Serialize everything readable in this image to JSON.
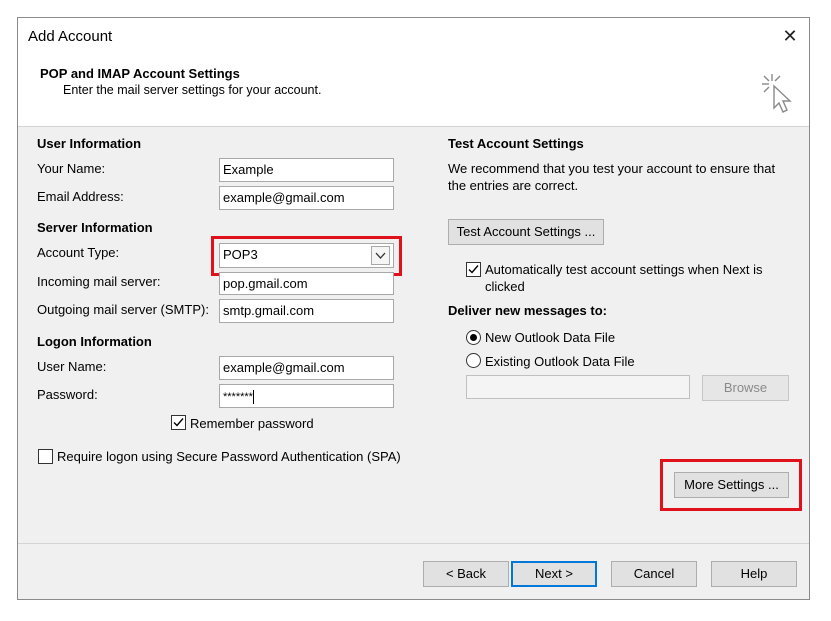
{
  "window": {
    "title": "Add Account",
    "close_glyph": "✕"
  },
  "header": {
    "title": "POP and IMAP Account Settings",
    "subtitle": "Enter the mail server settings for your account."
  },
  "user_info": {
    "heading": "User Information",
    "name_label": "Your Name:",
    "name_value": "Example",
    "email_label": "Email Address:",
    "email_value": "example@gmail.com"
  },
  "server_info": {
    "heading": "Server Information",
    "account_type_label": "Account Type:",
    "account_type_value": "POP3",
    "incoming_label": "Incoming mail server:",
    "incoming_value": "pop.gmail.com",
    "outgoing_label": "Outgoing mail server (SMTP):",
    "outgoing_value": "smtp.gmail.com"
  },
  "logon_info": {
    "heading": "Logon Information",
    "username_label": "User Name:",
    "username_value": "example@gmail.com",
    "password_label": "Password:",
    "password_value": "*******",
    "remember_label": "Remember password",
    "remember_checked": true,
    "spa_label": "Require logon using Secure Password Authentication (SPA)",
    "spa_checked": false
  },
  "test_settings": {
    "heading": "Test Account Settings",
    "description_line1": "We recommend that you test your account to ensure that",
    "description_line2": "the entries are correct.",
    "test_button": "Test Account Settings ...",
    "auto_test_line1": "Automatically test account settings when Next is",
    "auto_test_line2": "clicked",
    "auto_test_checked": true
  },
  "deliver": {
    "heading": "Deliver new messages to:",
    "option_new": "New Outlook Data File",
    "option_existing": "Existing Outlook Data File",
    "selected": "new",
    "existing_path_value": "",
    "browse_button": "Browse"
  },
  "more_settings_button": "More Settings ...",
  "footer": {
    "back": "< Back",
    "next": "Next >",
    "cancel": "Cancel",
    "help": "Help"
  },
  "colors": {
    "highlight": "#e0111b",
    "dialog_bg": "#f0f0f0",
    "primary_border": "#0078d7"
  },
  "icons": {
    "wizard": "wizard-cursor-icon",
    "dropdown": "chevron-down-icon",
    "check": "checkmark-icon"
  }
}
